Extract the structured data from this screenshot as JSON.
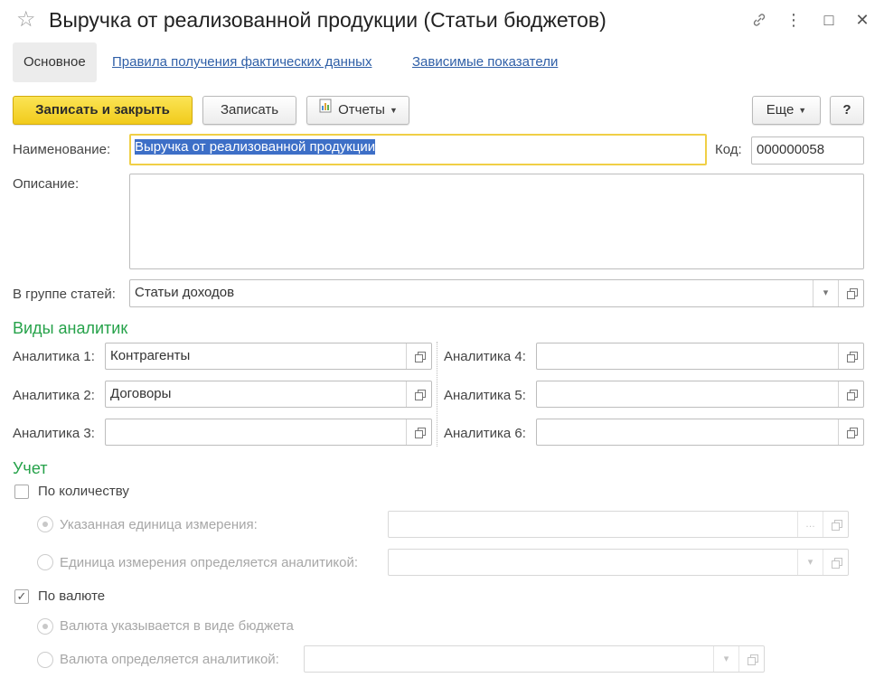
{
  "window": {
    "title": "Выручка от реализованной продукции (Статьи бюджетов)",
    "link_glyph": "🔗",
    "menu_glyph": "⋮",
    "max_glyph": "□",
    "close_glyph": "✕",
    "star_glyph": "☆"
  },
  "nav": {
    "main_tab": "Основное",
    "links": [
      "Правила получения фактических данных",
      "Зависимые показатели"
    ]
  },
  "toolbar": {
    "save_close": "Записать и закрыть",
    "save": "Записать",
    "reports": "Отчеты",
    "more": "Еще",
    "help": "?"
  },
  "form": {
    "name_label": "Наименование:",
    "name_value": "Выручка от реализованной продукции",
    "code_label": "Код:",
    "code_value": "000000058",
    "description_label": "Описание:",
    "description_value": "",
    "group_label": "В группе статей:",
    "group_value": "Статьи доходов"
  },
  "analytics": {
    "title": "Виды аналитик",
    "items": [
      {
        "label": "Аналитика 1:",
        "value": "Контрагенты"
      },
      {
        "label": "Аналитика 2:",
        "value": "Договоры"
      },
      {
        "label": "Аналитика 3:",
        "value": ""
      },
      {
        "label": "Аналитика 4:",
        "value": ""
      },
      {
        "label": "Аналитика 5:",
        "value": ""
      },
      {
        "label": "Аналитика 6:",
        "value": ""
      }
    ]
  },
  "accounting": {
    "title": "Учет",
    "by_quantity": {
      "label": "По количеству",
      "checked": false
    },
    "unit_specified": {
      "label": "Указанная единица измерения:",
      "selected": true,
      "value": ""
    },
    "unit_by_analytics": {
      "label": "Единица измерения определяется аналитикой:",
      "selected": false,
      "value": ""
    },
    "by_currency": {
      "label": "По валюте",
      "checked": true
    },
    "currency_budget": {
      "label": "Валюта указывается в виде бюджета",
      "selected": true
    },
    "currency_analytics": {
      "label": "Валюта определяется аналитикой:",
      "selected": false,
      "value": ""
    }
  },
  "colors": {
    "accent_green": "#26a24a",
    "primary_button": "#f1cb1b",
    "link_blue": "#2f5fa7",
    "selection": "#3d6fc7"
  }
}
